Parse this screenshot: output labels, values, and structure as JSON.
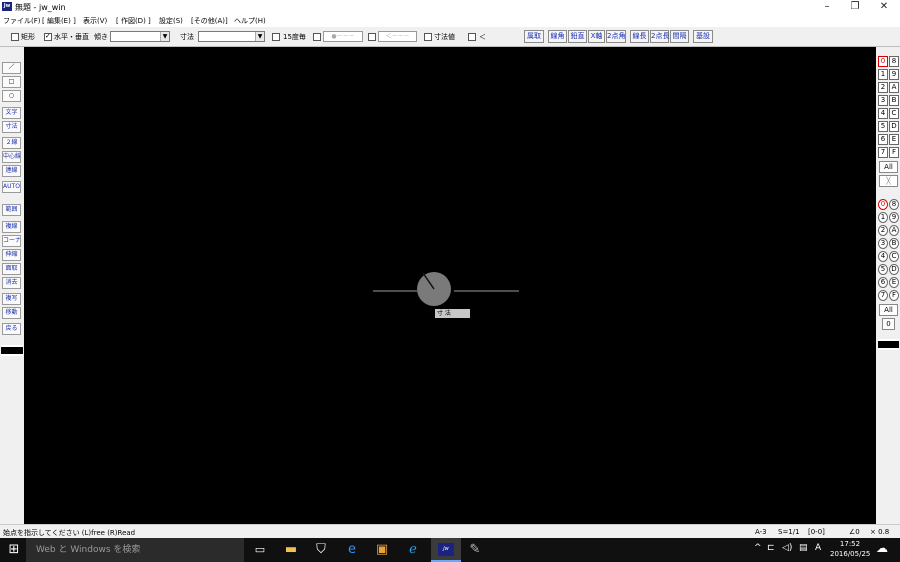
{
  "window": {
    "app_icon_label": "Jw",
    "title": "無題 - jw_win",
    "minimize": "–",
    "maximize": "❐",
    "close": "✕"
  },
  "menu": [
    "ファイル(F)",
    "[ 編集(E) ]",
    "表示(V)",
    "[ 作図(D) ]",
    "設定(S)",
    "[その他(A)]",
    "ヘルプ(H)"
  ],
  "toolbar": {
    "rect_label": "矩形",
    "hv_label": "水平・垂直",
    "angle_label": "傾き",
    "angle_value": "",
    "dim_label": "寸法",
    "dim_value": "",
    "deg15_label": "15度毎",
    "dim_btn1": "●－－－",
    "dim_btn2": "＜－－－",
    "dimval_label": "寸法値",
    "lt_label": "＜",
    "right_buttons": [
      "属取",
      "線角",
      "鉛直",
      "X軸",
      "2点角",
      "線長",
      "2点長",
      "間隔",
      "基設"
    ]
  },
  "left_tools": [
    "／",
    "□",
    "○",
    "文字",
    "寸法",
    "２線",
    "中心線",
    "連線",
    "AUTO",
    "範囲",
    "複線",
    "コーナー",
    "伸縮",
    "面取",
    "消去",
    "複写",
    "移動",
    "戻る"
  ],
  "layer_groups_top": {
    "rows": [
      [
        "0",
        "8"
      ],
      [
        "1",
        "9"
      ],
      [
        "2",
        "A"
      ],
      [
        "3",
        "B"
      ],
      [
        "4",
        "C"
      ],
      [
        "5",
        "D"
      ],
      [
        "6",
        "E"
      ],
      [
        "7",
        "F"
      ]
    ],
    "all": "All",
    "cross": "╳"
  },
  "layers_bottom": {
    "rows": [
      [
        "0",
        "8"
      ],
      [
        "1",
        "9"
      ],
      [
        "2",
        "A"
      ],
      [
        "3",
        "B"
      ],
      [
        "4",
        "C"
      ],
      [
        "5",
        "D"
      ],
      [
        "6",
        "E"
      ],
      [
        "7",
        "F"
      ]
    ],
    "all": "All",
    "zero": "0"
  },
  "canvas": {
    "dim_tag": "寸 法"
  },
  "status": {
    "message": "始点を指示してください (L)free (R)Read",
    "paper": "A-3",
    "scale": "S=1/1",
    "layer": "[0-0]",
    "angle": "∠0",
    "zoom": "× 0.8"
  },
  "taskbar": {
    "search_placeholder": "Web と Windows を検索",
    "time": "17:52",
    "date": "2016/05/25",
    "ime": "A"
  }
}
